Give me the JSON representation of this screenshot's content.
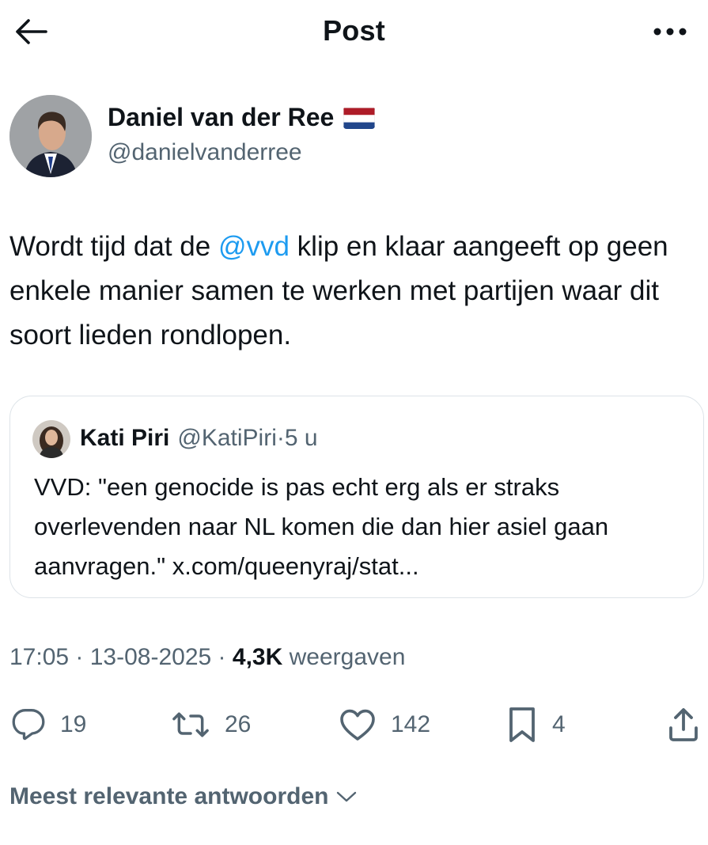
{
  "header": {
    "title": "Post",
    "back_icon": "arrow-left-icon",
    "more_icon": "more-horizontal-icon"
  },
  "author": {
    "name": "Daniel van der Ree",
    "flag": "🇳🇱",
    "handle": "@danielvanderree"
  },
  "post": {
    "text_before": "Wordt tijd dat de ",
    "mention": "@vvd",
    "text_after": " klip en klaar aangeeft op geen enkele manier samen te werken met partijen waar dit soort lieden rondlopen."
  },
  "quote": {
    "name": "Kati Piri",
    "handle": "@KatiPiri",
    "separator": " · ",
    "time": "5 u",
    "text": "VVD: \"een genocide is pas echt erg als er straks overlevenden naar NL komen die dan hier asiel gaan aanvragen.\" x.com/queenyraj/stat..."
  },
  "meta": {
    "time": "17:05",
    "date": "13-08-2025",
    "separator": " · ",
    "views": "4,3K",
    "views_label": "weergaven"
  },
  "actions": {
    "replies": "19",
    "reposts": "26",
    "likes": "142",
    "bookmarks": "4"
  },
  "sort": {
    "label": "Meest relevante antwoorden"
  },
  "colors": {
    "link": "#1d9bf0",
    "secondary_text": "#536471",
    "primary_text": "#0f1419",
    "border": "#dde3e8"
  }
}
